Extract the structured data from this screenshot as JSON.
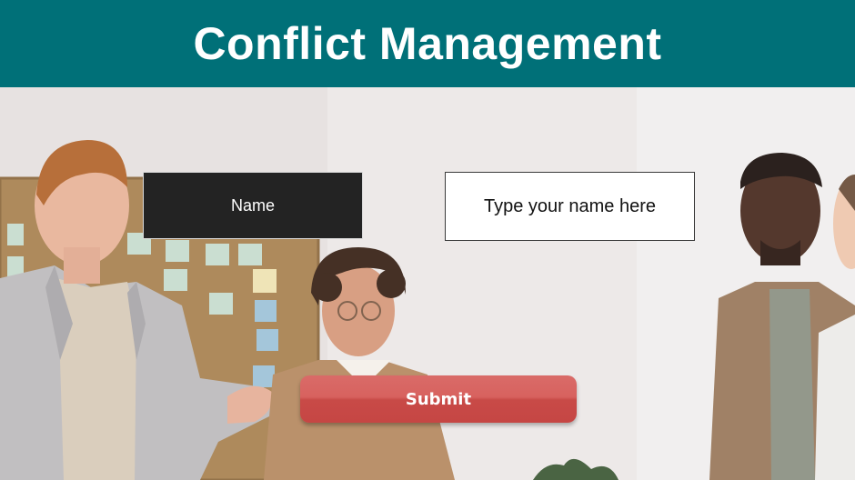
{
  "header": {
    "title": "Conflict Management"
  },
  "form": {
    "name_label": "Name",
    "name_placeholder": "Type your name here",
    "submit_label": "Submit"
  },
  "background": {
    "description_icon": "office-team-photo"
  },
  "colors": {
    "header_bg": "#007078",
    "label_box_bg": "#232323",
    "submit_bg": "#d35b58"
  }
}
